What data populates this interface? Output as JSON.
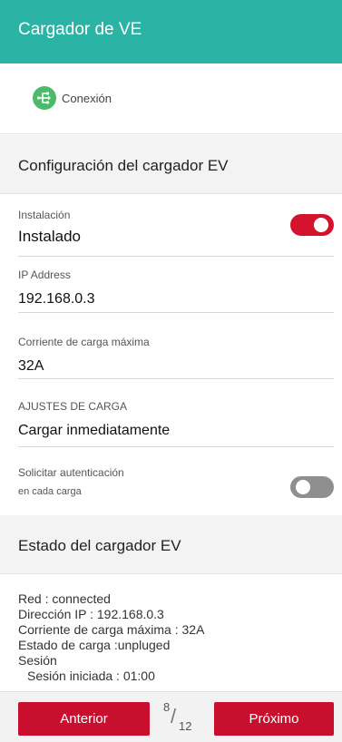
{
  "header": {
    "title": "Cargador de VE"
  },
  "connection": {
    "label": "Conexión",
    "icon": "usb-connection-icon"
  },
  "config_section": {
    "title": "Configuración del cargador EV"
  },
  "installation": {
    "label": "Instalación",
    "value": "Instalado",
    "toggle_on": true
  },
  "ip": {
    "label": "IP Address",
    "value": "192.168.0.3"
  },
  "max_current": {
    "label": "Corriente de carga máxima",
    "value": "32A"
  },
  "charge_settings": {
    "label": "AJUSTES DE CARGA",
    "value": "Cargar inmediatamente"
  },
  "auth": {
    "label": "Solicitar autenticación",
    "sublabel": "en cada carga",
    "toggle_on": false
  },
  "status_section": {
    "title": "Estado del cargador EV"
  },
  "status": {
    "lines": [
      "Red : connected",
      "Dirección IP : 192.168.0.3",
      "Corriente de carga máxima : 32A",
      "Estado de carga :unpluged",
      "Sesión",
      "Sesión iniciada : 01:00"
    ]
  },
  "footer": {
    "prev_label": "Anterior",
    "next_label": "Próximo",
    "page_current": "8",
    "page_total": "12"
  },
  "colors": {
    "header": "#2bb3a6",
    "accent": "#c8102e",
    "toggle_on": "#d4142d",
    "toggle_off": "#8f8f8f",
    "icon_bg": "#4cb96b"
  }
}
